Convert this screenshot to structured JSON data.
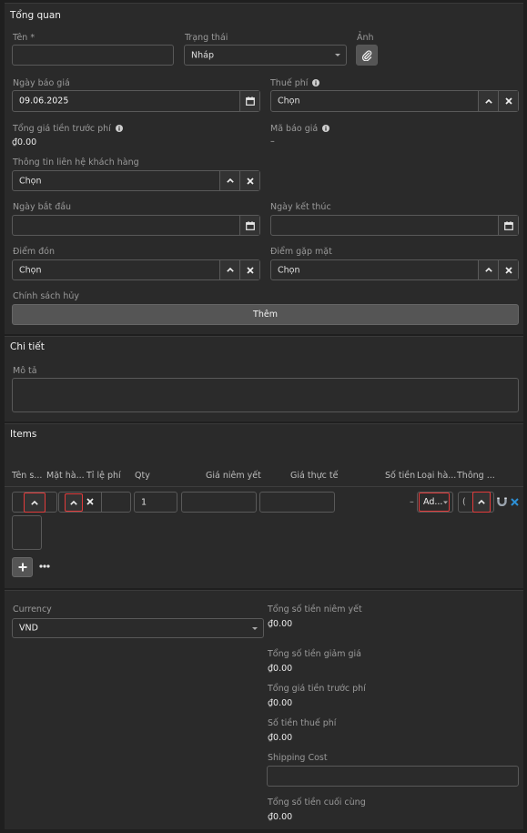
{
  "sections": {
    "overview": "Tổng quan",
    "details": "Chi tiết",
    "items": "Items"
  },
  "fields": {
    "name_label": "Tên *",
    "name_value": "",
    "status_label": "Trạng thái",
    "status_value": "Nháp",
    "photo_label": "Ảnh",
    "quote_date_label": "Ngày báo giá",
    "quote_date_value": "09.06.2025",
    "tax_label": "Thuế phí",
    "tax_value": "Chọn",
    "total_before_tax_label": "Tổng giá tiền trước phí",
    "total_before_tax_value": "₫0.00",
    "quote_code_label": "Mã báo giá",
    "quote_code_value": "–",
    "contact_label": "Thông tin liên hệ khách hàng",
    "contact_value": "Chọn",
    "start_date_label": "Ngày bắt đầu",
    "end_date_label": "Ngày kết thúc",
    "pickup_label": "Điểm đón",
    "pickup_value": "Chọn",
    "meeting_label": "Điểm gặp mặt",
    "meeting_value": "Chọn",
    "cancel_policy_label": "Chính sách hủy",
    "add_button": "Thêm",
    "description_label": "Mô tả"
  },
  "items_table": {
    "columns": [
      "Tên s...",
      "Mặt hà...",
      "Tỉ lệ phí",
      "Qty",
      "Giá niêm yết",
      "Giá thực tế",
      "Số tiền",
      "Loại hà...",
      "Thông ..."
    ],
    "row": {
      "qty": "1",
      "amount": "–",
      "type": "Ad...",
      "info": "("
    }
  },
  "summary": {
    "currency_label": "Currency",
    "currency_value": "VND",
    "listed_total_label": "Tổng số tiền niêm yết",
    "listed_total_value": "₫0.00",
    "discount_label": "Tổng số tiền giảm giá",
    "discount_value": "₫0.00",
    "before_tax_label": "Tổng giá tiền trước phí",
    "before_tax_value": "₫0.00",
    "tax_amount_label": "Số tiền thuế phí",
    "tax_amount_value": "₫0.00",
    "shipping_label": "Shipping Cost",
    "shipping_value": "",
    "final_label": "Tổng số tiền cuối cùng",
    "final_value": "₫0.00"
  },
  "colors": {
    "background": "#1f1f1f",
    "panel": "#2a2a2a",
    "highlight": "#e23b3b",
    "accent_blue": "#2d8fd5"
  },
  "icons": [
    "paperclip-icon",
    "calendar-icon",
    "chevron-up-icon",
    "close-icon",
    "info-icon",
    "plus-icon",
    "more-icon",
    "magnet-icon"
  ]
}
